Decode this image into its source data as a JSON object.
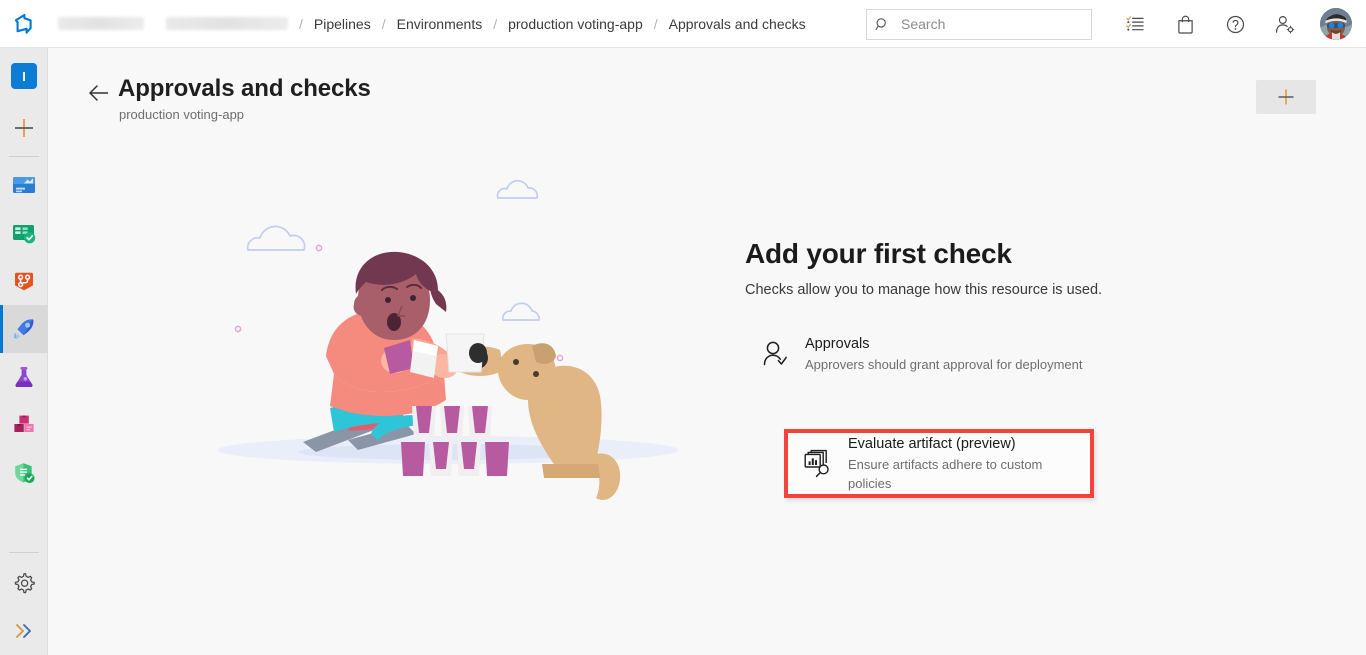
{
  "topbar": {
    "logo_icon": "azure-devops-logo-icon",
    "breadcrumb": [
      {
        "label": "",
        "redacted": true
      },
      {
        "label": "",
        "redacted": true
      },
      {
        "label": "Pipelines",
        "redacted": false
      },
      {
        "label": "Environments",
        "redacted": false
      },
      {
        "label": "production voting-app",
        "redacted": false
      },
      {
        "label": "Approvals and checks",
        "redacted": false
      }
    ],
    "separator": "/",
    "search": {
      "placeholder": "Search",
      "value": "",
      "icon": "search-icon"
    },
    "icons": [
      {
        "name": "task-list-icon",
        "title": "Work items"
      },
      {
        "name": "marketplace-bag-icon",
        "title": "Marketplace"
      },
      {
        "name": "help-question-icon",
        "title": "Help"
      },
      {
        "name": "user-settings-icon",
        "title": "User settings"
      }
    ],
    "avatar": {
      "name": "user-avatar",
      "alt": "User profile photo"
    }
  },
  "rail": {
    "project_initial": "I",
    "items": [
      {
        "name": "project-avatar",
        "label": "Project",
        "selected": false
      },
      {
        "name": "new-item-plus",
        "label": "New",
        "selected": false
      },
      {
        "name": "overview-icon",
        "label": "Overview",
        "selected": false
      },
      {
        "name": "boards-icon",
        "label": "Boards",
        "selected": false
      },
      {
        "name": "repos-icon",
        "label": "Repos",
        "selected": false
      },
      {
        "name": "pipelines-icon",
        "label": "Pipelines",
        "selected": true
      },
      {
        "name": "test-plans-icon",
        "label": "Test Plans",
        "selected": false
      },
      {
        "name": "artifacts-icon",
        "label": "Artifacts",
        "selected": false
      },
      {
        "name": "advanced-security-icon",
        "label": "Advanced Security",
        "selected": false
      }
    ],
    "bottom": [
      {
        "name": "settings-gear-icon",
        "label": "Project settings"
      },
      {
        "name": "expand-chevrons-icon",
        "label": "Expand"
      }
    ]
  },
  "page": {
    "back_label": "Back",
    "title": "Approvals and checks",
    "subtitle": "production voting-app",
    "add_button_label": "+"
  },
  "panel": {
    "title": "Add your first check",
    "description": "Checks allow you to manage how this resource is used.",
    "checks": [
      {
        "icon": "approvals-person-check-icon",
        "title": "Approvals",
        "subtitle": "Approvers should grant approval for deployment",
        "highlighted": false
      },
      {
        "icon": "evaluate-artifact-icon",
        "title": "Evaluate artifact (preview)",
        "subtitle": "Ensure artifacts adhere to custom policies",
        "highlighted": true
      }
    ]
  },
  "colors": {
    "accent": "#0078d4",
    "highlight_red": "#f4433b",
    "rail_bg": "#eaeaea",
    "content_bg": "#f8f8f8"
  }
}
